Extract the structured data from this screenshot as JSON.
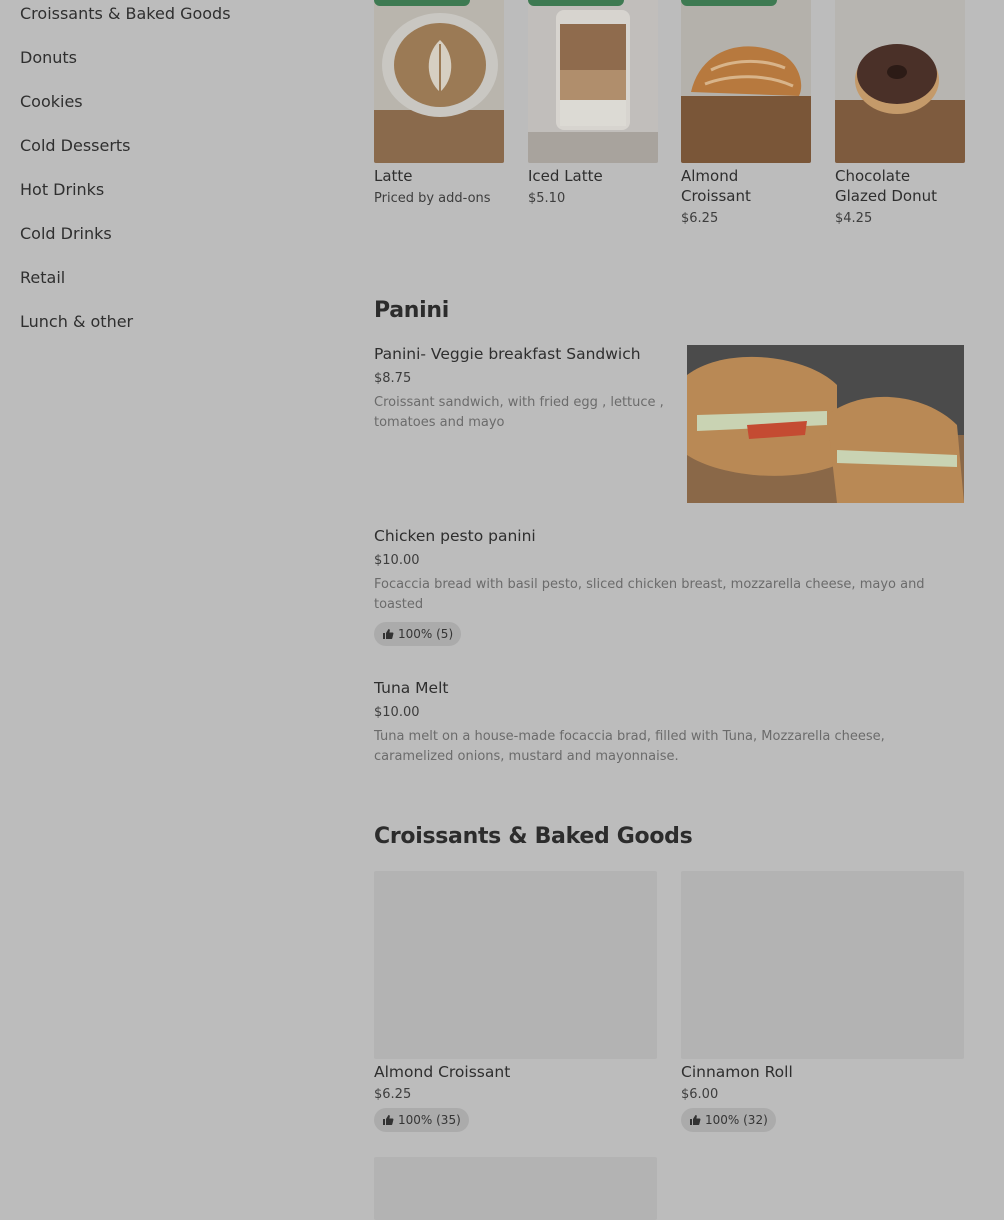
{
  "sidebar": {
    "items": [
      {
        "label": "Croissants & Baked Goods"
      },
      {
        "label": "Donuts"
      },
      {
        "label": "Cookies"
      },
      {
        "label": "Cold Desserts"
      },
      {
        "label": "Hot Drinks"
      },
      {
        "label": "Cold Drinks"
      },
      {
        "label": "Retail"
      },
      {
        "label": "Lunch & other"
      }
    ]
  },
  "featured": [
    {
      "name": "Latte",
      "price": "Priced by add-ons"
    },
    {
      "name": "Iced Latte",
      "price": "$5.10"
    },
    {
      "name": "Almond Croissant",
      "price": "$6.25"
    },
    {
      "name": "Chocolate Glazed Donut",
      "price": "$4.25"
    }
  ],
  "panini": {
    "title": "Panini",
    "items": [
      {
        "name": "Panini- Veggie breakfast Sandwich",
        "price": "$8.75",
        "description": "Croissant sandwich, with fried egg , lettuce , tomatoes and mayo"
      },
      {
        "name": "Chicken pesto panini",
        "price": "$10.00",
        "description": "Focaccia bread with basil pesto, sliced chicken breast, mozzarella cheese, mayo and toasted",
        "rating": "100% (5)"
      },
      {
        "name": "Tuna Melt",
        "price": "$10.00",
        "description": "Tuna melt on a house-made focaccia brad, filled with Tuna, Mozzarella cheese, caramelized onions, mustard and mayonnaise."
      }
    ]
  },
  "baked": {
    "title": "Croissants & Baked Goods",
    "items": [
      {
        "name": "Almond Croissant",
        "price": "$6.25",
        "rating": "100% (35)"
      },
      {
        "name": "Cinnamon Roll",
        "price": "$6.00",
        "rating": "100% (32)"
      }
    ]
  },
  "colors": {
    "overlay_bg": "#bcbcbc",
    "tag_green": "#3e7a52"
  }
}
